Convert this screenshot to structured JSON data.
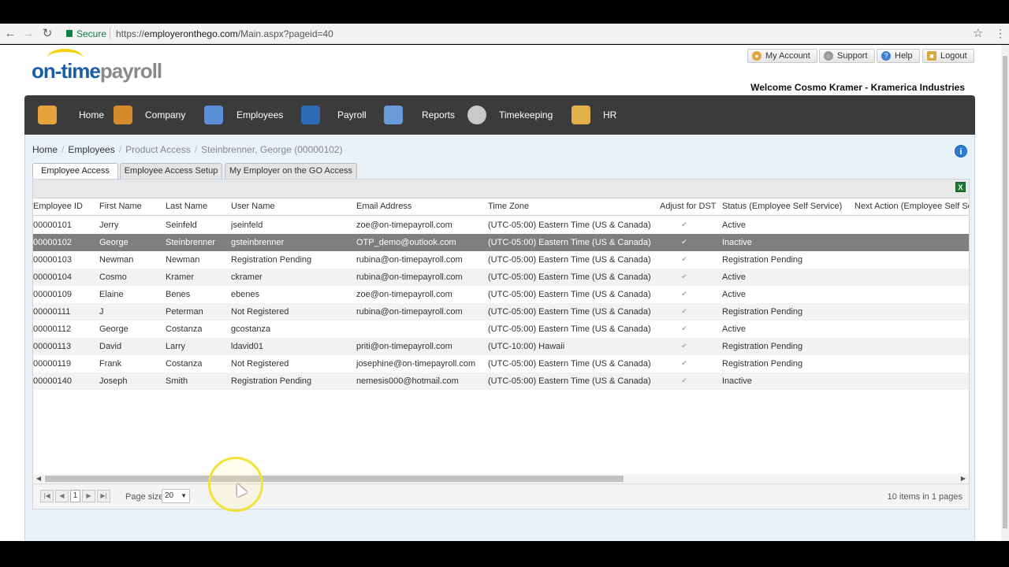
{
  "browser": {
    "secure_label": "Secure",
    "url_scheme": "https://",
    "url_host": "employeronthego.com",
    "url_path": "/Main.aspx?pageid=40"
  },
  "logo": {
    "part1": "on-time",
    "part2": "payroll"
  },
  "top_links": {
    "my_account": "My Account",
    "support": "Support",
    "help": "Help",
    "logout": "Logout"
  },
  "welcome": "Welcome Cosmo Kramer - Kramerica Industries",
  "main_nav": [
    {
      "label": "Home",
      "icon": "home-icon",
      "color": "#e6a33c"
    },
    {
      "label": "Company",
      "icon": "company-icon",
      "color": "#d58b2a"
    },
    {
      "label": "Employees",
      "icon": "employees-icon",
      "color": "#5b8fd6"
    },
    {
      "label": "Payroll",
      "icon": "payroll-icon",
      "color": "#2c6bb5"
    },
    {
      "label": "Reports",
      "icon": "reports-icon",
      "color": "#6a9ad8"
    },
    {
      "label": "Timekeeping",
      "icon": "clock-icon",
      "color": "#c9c9c9"
    },
    {
      "label": "HR",
      "icon": "hr-icon",
      "color": "#e3b04b"
    }
  ],
  "breadcrumb": {
    "home": "Home",
    "employees": "Employees",
    "product_access": "Product Access",
    "current": "Steinbrenner, George (00000102)"
  },
  "tabs": [
    "Employee Access",
    "Employee Access Setup",
    "My Employer on the GO Access"
  ],
  "grid": {
    "columns": [
      "Employee ID",
      "First Name",
      "Last Name",
      "User Name",
      "Email Address",
      "Time Zone",
      "Adjust for DST",
      "Status (Employee Self Service)",
      "Next Action (Employee Self Servic"
    ],
    "rows": [
      [
        "00000101",
        "Jerry",
        "Seinfeld",
        "jseinfeld",
        "zoe@on-timepayroll.com",
        "(UTC-05:00) Eastern Time (US & Canada)",
        "Active",
        ""
      ],
      [
        "00000102",
        "George",
        "Steinbrenner",
        "gsteinbrenner",
        "OTP_demo@outlook.com",
        "(UTC-05:00) Eastern Time (US & Canada)",
        "Inactive",
        ""
      ],
      [
        "00000103",
        "Newman",
        "Newman",
        "Registration Pending",
        "rubina@on-timepayroll.com",
        "(UTC-05:00) Eastern Time (US & Canada)",
        "Registration Pending",
        ""
      ],
      [
        "00000104",
        "Cosmo",
        "Kramer",
        "ckramer",
        "rubina@on-timepayroll.com",
        "(UTC-05:00) Eastern Time (US & Canada)",
        "Active",
        ""
      ],
      [
        "00000109",
        "Elaine",
        "Benes",
        "ebenes",
        "zoe@on-timepayroll.com",
        "(UTC-05:00) Eastern Time (US & Canada)",
        "Active",
        ""
      ],
      [
        "00000111",
        "J",
        "Peterman",
        "Not Registered",
        "rubina@on-timepayroll.com",
        "(UTC-05:00) Eastern Time (US & Canada)",
        "Registration Pending",
        ""
      ],
      [
        "00000112",
        "George",
        "Costanza",
        "gcostanza",
        "",
        "(UTC-05:00) Eastern Time (US & Canada)",
        "Active",
        ""
      ],
      [
        "00000113",
        "David",
        "Larry",
        "ldavid01",
        "priti@on-timepayroll.com",
        "(UTC-10:00) Hawaii",
        "Registration Pending",
        ""
      ],
      [
        "00000119",
        "Frank",
        "Costanza",
        "Not Registered",
        "josephine@on-timepayroll.com",
        "(UTC-05:00) Eastern Time (US & Canada)",
        "Registration Pending",
        ""
      ],
      [
        "00000140",
        "Joseph",
        "Smith",
        "Registration Pending",
        "nemesis000@hotmail.com",
        "(UTC-05:00) Eastern Time (US & Canada)",
        "Inactive",
        ""
      ]
    ],
    "selected_row": 1
  },
  "pager": {
    "current_page": "1",
    "page_size_label": "Page size:",
    "page_size": "20",
    "items_info": "10 items in 1 pages"
  }
}
